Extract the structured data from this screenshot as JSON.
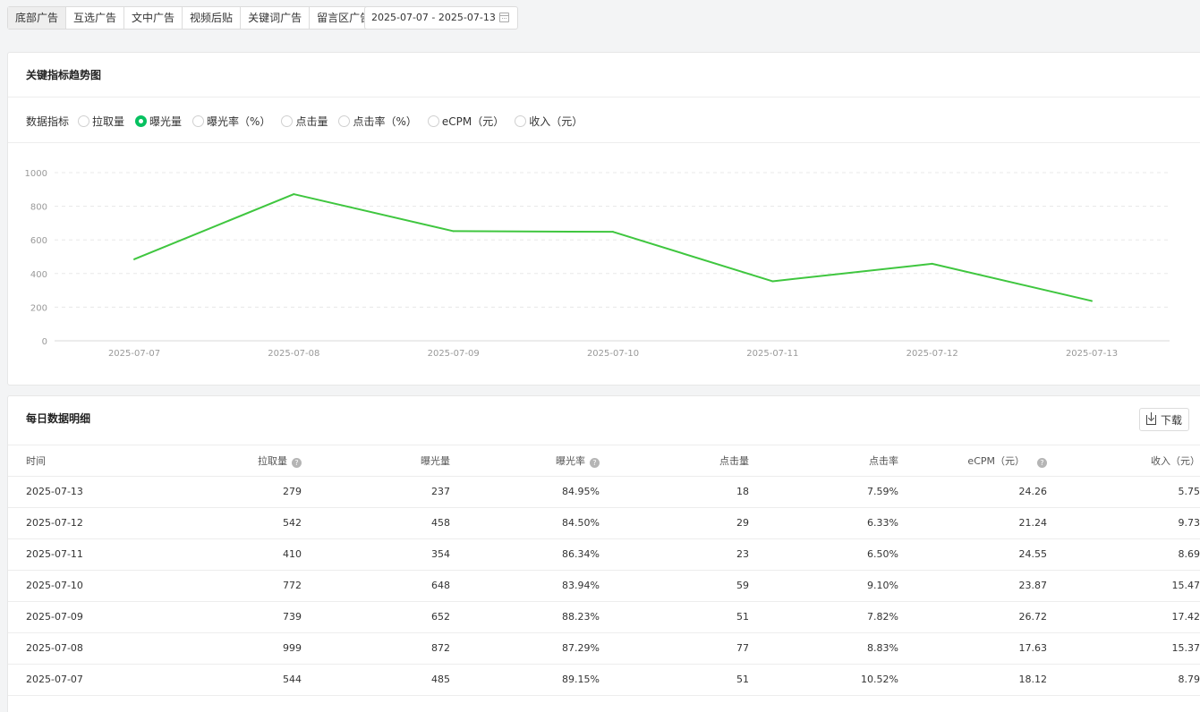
{
  "tabs": [
    "底部广告",
    "互选广告",
    "文中广告",
    "视频后贴",
    "关键词广告",
    "留言区广告"
  ],
  "active_tab": 0,
  "date_range": "2025-07-07 - 2025-07-13",
  "trend": {
    "title": "关键指标趋势图",
    "metric_label": "数据指标",
    "metrics": [
      "拉取量",
      "曝光量",
      "曝光率（%）",
      "点击量",
      "点击率（%）",
      "eCPM（元）",
      "收入（元）"
    ],
    "selected_metric": 1
  },
  "chart_data": {
    "type": "line",
    "x": [
      "2025-07-07",
      "2025-07-08",
      "2025-07-09",
      "2025-07-10",
      "2025-07-11",
      "2025-07-12",
      "2025-07-13"
    ],
    "series": [
      {
        "values": [
          485,
          872,
          652,
          648,
          354,
          458,
          237
        ]
      }
    ],
    "ylim": [
      0,
      1000
    ],
    "yticks": [
      0,
      200,
      400,
      600,
      800,
      1000
    ],
    "grid": true,
    "color": "#3fc63f"
  },
  "daily": {
    "title": "每日数据明细",
    "download_label": "下载",
    "columns": [
      "时间",
      "拉取量",
      "曝光量",
      "曝光率",
      "点击量",
      "点击率",
      "eCPM（元）",
      "收入（元）"
    ],
    "rows": [
      [
        "2025-07-13",
        "279",
        "237",
        "84.95%",
        "18",
        "7.59%",
        "24.26",
        "5.75"
      ],
      [
        "2025-07-12",
        "542",
        "458",
        "84.50%",
        "29",
        "6.33%",
        "21.24",
        "9.73"
      ],
      [
        "2025-07-11",
        "410",
        "354",
        "86.34%",
        "23",
        "6.50%",
        "24.55",
        "8.69"
      ],
      [
        "2025-07-10",
        "772",
        "648",
        "83.94%",
        "59",
        "9.10%",
        "23.87",
        "15.47"
      ],
      [
        "2025-07-09",
        "739",
        "652",
        "88.23%",
        "51",
        "7.82%",
        "26.72",
        "17.42"
      ],
      [
        "2025-07-08",
        "999",
        "872",
        "87.29%",
        "77",
        "8.83%",
        "17.63",
        "15.37"
      ],
      [
        "2025-07-07",
        "544",
        "485",
        "89.15%",
        "51",
        "10.52%",
        "18.12",
        "8.79"
      ]
    ]
  }
}
